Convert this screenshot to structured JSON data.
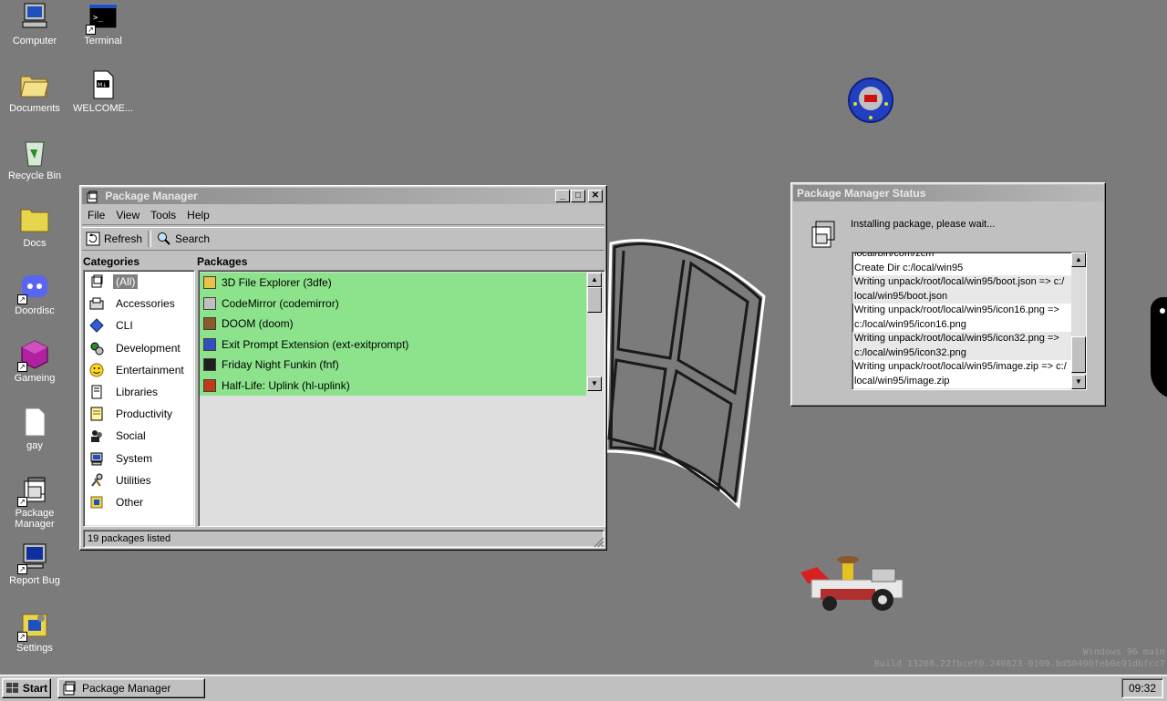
{
  "desktop": {
    "icons": [
      {
        "label": "Computer"
      },
      {
        "label": "Terminal"
      },
      {
        "label": "Documents"
      },
      {
        "label": "WELCOME..."
      },
      {
        "label": "Recycle Bin"
      },
      {
        "label": "Docs"
      },
      {
        "label": "Doordisc"
      },
      {
        "label": "Gameing"
      },
      {
        "label": "gay"
      },
      {
        "label": "Package Manager"
      },
      {
        "label": "Report Bug"
      },
      {
        "label": "Settings"
      }
    ],
    "watermark": {
      "line1": "Windows 96 main",
      "line2": "Build 13208.22fbcef0.240823-0109.bd50490feb0e91dbfcc7"
    }
  },
  "package_manager": {
    "title": "Package Manager",
    "menu": [
      "File",
      "View",
      "Tools",
      "Help"
    ],
    "toolbar": {
      "refresh": "Refresh",
      "search": "Search"
    },
    "categories_heading": "Categories",
    "packages_heading": "Packages",
    "categories": [
      {
        "label": "(All)",
        "icon": "all-icon",
        "selected": true
      },
      {
        "label": "Accessories",
        "icon": "accessories-icon"
      },
      {
        "label": "CLI",
        "icon": "cli-icon"
      },
      {
        "label": "Development",
        "icon": "development-icon"
      },
      {
        "label": "Entertainment",
        "icon": "entertainment-icon"
      },
      {
        "label": "Libraries",
        "icon": "libraries-icon"
      },
      {
        "label": "Productivity",
        "icon": "productivity-icon"
      },
      {
        "label": "Social",
        "icon": "social-icon"
      },
      {
        "label": "System",
        "icon": "system-icon"
      },
      {
        "label": "Utilities",
        "icon": "utilities-icon"
      },
      {
        "label": "Other",
        "icon": "other-icon"
      }
    ],
    "packages": [
      {
        "label": "3D File Explorer (3dfe)",
        "icon": "folder-icon",
        "color": "#e8c24a"
      },
      {
        "label": "CodeMirror (codemirror)",
        "icon": "disc-icon",
        "color": "#bfbfbf"
      },
      {
        "label": "DOOM (doom)",
        "icon": "doom-icon",
        "color": "#8a5a2a"
      },
      {
        "label": "Exit Prompt Extension (ext-exitprompt)",
        "icon": "book-icon",
        "color": "#3050c0"
      },
      {
        "label": "Friday Night Funkin (fnf)",
        "icon": "fnf-icon",
        "color": "#202020"
      },
      {
        "label": "Half-Life: Uplink (hl-uplink)",
        "icon": "lambda-icon",
        "color": "#c03a1a"
      }
    ],
    "status": "19 packages listed",
    "installed_color": "#8ce38c"
  },
  "status_window": {
    "title": "Package Manager Status",
    "message": "Installing package, please wait...",
    "log": [
      "local/bin/com/zcm",
      "Create Dir c:/local/win95",
      "Writing unpack/root/local/win95/boot.json => c:/",
      "local/win95/boot.json",
      "Writing unpack/root/local/win95/icon16.png =>",
      "c:/local/win95/icon16.png",
      "Writing unpack/root/local/win95/icon32.png =>",
      "c:/local/win95/icon32.png",
      "Writing unpack/root/local/win95/image.zip => c:/",
      "local/win95/image.zip"
    ]
  },
  "taskbar": {
    "start": "Start",
    "tasks": [
      {
        "label": "Package Manager"
      }
    ],
    "clock": "09:32"
  }
}
